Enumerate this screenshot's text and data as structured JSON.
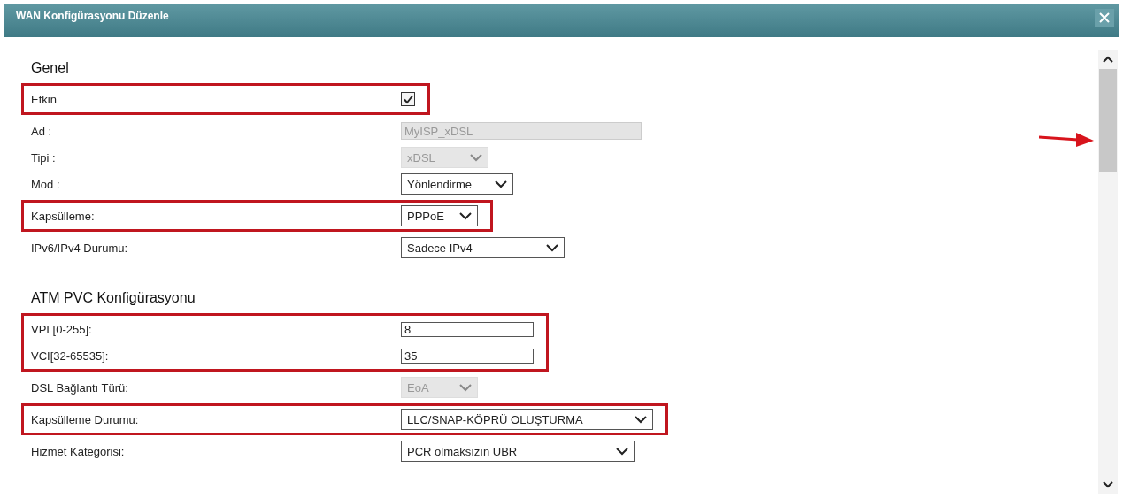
{
  "window": {
    "title": "WAN Konfigürasyonu Düzenle"
  },
  "sections": [
    {
      "title": "Genel",
      "blocks": [
        {
          "highlighted": true,
          "rows": [
            {
              "kind": "checkbox",
              "label": "Etkin",
              "checked": true
            }
          ]
        },
        {
          "highlighted": false,
          "rows": [
            {
              "kind": "text",
              "label": "Ad :",
              "value": "MyISP_xDSL",
              "disabled": true
            },
            {
              "kind": "select",
              "label": "Tipi :",
              "value": "xDSL",
              "disabled": true
            },
            {
              "kind": "select",
              "label": "Mod :",
              "value": "Yönlendirme",
              "disabled": false
            }
          ]
        },
        {
          "highlighted": true,
          "rows": [
            {
              "kind": "select",
              "label": "Kapsülleme:",
              "value": "PPPoE",
              "disabled": false
            }
          ]
        },
        {
          "highlighted": false,
          "rows": [
            {
              "kind": "select",
              "label": "IPv6/IPv4 Durumu:",
              "value": "Sadece IPv4",
              "disabled": false
            }
          ]
        }
      ]
    },
    {
      "title": "ATM PVC Konfigürasyonu",
      "blocks": [
        {
          "highlighted": true,
          "rows": [
            {
              "kind": "text",
              "label": "VPI [0-255]:",
              "value": "8",
              "disabled": false
            },
            {
              "kind": "text",
              "label": "VCI[32-65535]:",
              "value": "35",
              "disabled": false
            }
          ]
        },
        {
          "highlighted": false,
          "rows": [
            {
              "kind": "select",
              "label": "DSL Bağlantı Türü:",
              "value": "EoA",
              "disabled": true
            }
          ]
        },
        {
          "highlighted": true,
          "rows": [
            {
              "kind": "select",
              "label": "Kapsülleme Durumu:",
              "value": "LLC/SNAP-KÖPRÜ OLUŞTURMA",
              "disabled": false
            }
          ]
        },
        {
          "highlighted": false,
          "rows": [
            {
              "kind": "select",
              "label": "Hizmet Kategorisi:",
              "value": "PCR olmaksızın UBR",
              "disabled": false
            }
          ]
        }
      ]
    }
  ]
}
